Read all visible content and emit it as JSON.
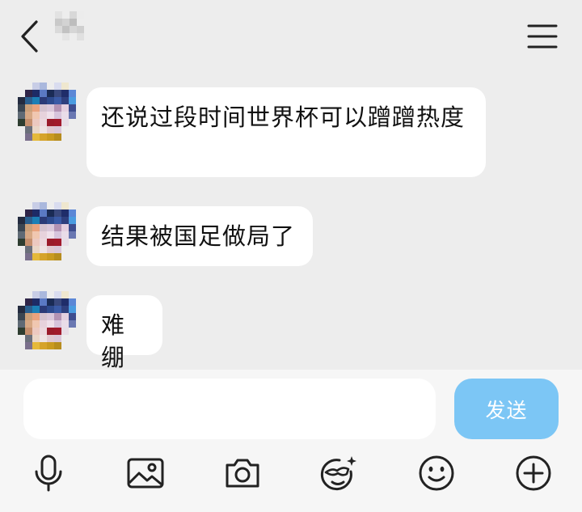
{
  "header": {
    "back_icon": "chevron-left-icon",
    "menu_icon": "hamburger-menu-icon",
    "title_image": "pixelated-contact-name"
  },
  "messages": [
    {
      "text": "还说过段时间世界杯可以蹭蹭热度",
      "avatar": "pixelated-avatar"
    },
    {
      "text": "结果被国足做局了",
      "avatar": "pixelated-avatar"
    },
    {
      "text": "难绷",
      "avatar": "pixelated-avatar"
    }
  ],
  "composer": {
    "input_value": "",
    "send_label": "发送",
    "send_color": "#7cc6f5"
  },
  "toolbar": {
    "icons": [
      "microphone-icon",
      "image-icon",
      "camera-icon",
      "sticker-icon",
      "emoji-icon",
      "plus-icon"
    ]
  }
}
